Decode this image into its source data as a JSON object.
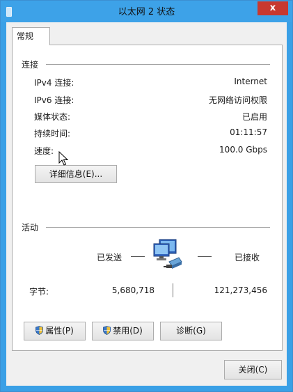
{
  "window": {
    "title": "以太网 2 状态",
    "close_glyph": "x"
  },
  "tabs": [
    {
      "label": "常规"
    }
  ],
  "connection": {
    "section_title": "连接",
    "rows": [
      {
        "label": "IPv4 连接:",
        "value": "Internet"
      },
      {
        "label": "IPv6 连接:",
        "value": "无网络访问权限"
      },
      {
        "label": "媒体状态:",
        "value": "已启用"
      },
      {
        "label": "持续时间:",
        "value": "01:11:57"
      },
      {
        "label": "速度:",
        "value": "100.0 Gbps"
      }
    ],
    "details_button": "详细信息(E)..."
  },
  "activity": {
    "section_title": "活动",
    "sent_label": "已发送",
    "received_label": "已接收",
    "bytes_label": "字节:",
    "bytes_sent": "5,680,718",
    "bytes_received": "121,273,456"
  },
  "actions": {
    "properties_button": "属性(P)",
    "disable_button": "禁用(D)",
    "diagnose_button": "诊断(G)"
  },
  "footer": {
    "close_button": "关闭(C)"
  },
  "colors": {
    "titlebar": "#3da2e8",
    "close": "#c8382f"
  }
}
